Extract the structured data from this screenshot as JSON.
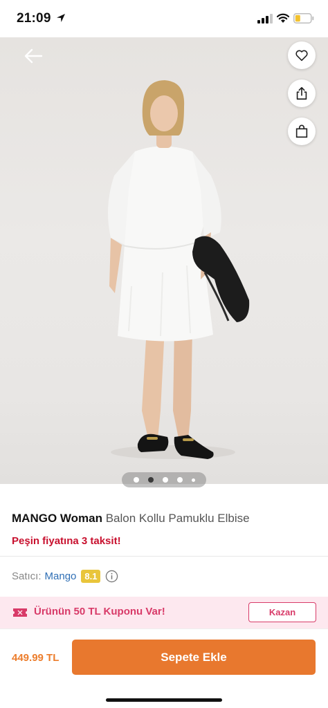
{
  "status_bar": {
    "time": "21:09",
    "icons": [
      "location-arrow-icon",
      "signal-icon",
      "wifi-icon",
      "battery-icon"
    ],
    "battery_color": "#f2c12e"
  },
  "top_actions": {
    "back_icon": "arrow-left-icon",
    "buttons": [
      "heart-icon",
      "share-icon",
      "shopping-bag-icon"
    ]
  },
  "gallery": {
    "total_dots": 5,
    "active_index": 1
  },
  "product": {
    "brand": "MANGO Woman",
    "name": " Balon Kollu Pamuklu Elbise",
    "installment": "Peşin fiyatına 3 taksit!"
  },
  "seller": {
    "label": "Satıcı:",
    "name": "Mango",
    "rating": "8.1",
    "info_icon": "info-circle-icon"
  },
  "coupon": {
    "icon": "ticket-icon",
    "text": "Ürünün 50 TL Kuponu Var!",
    "button_label": "Kazan",
    "accent_color": "#d83a68",
    "bg_color": "#fde8ef"
  },
  "checkout": {
    "price": "449.99 TL",
    "add_to_cart_label": "Sepete Ekle",
    "accent_color": "#e8782e"
  }
}
